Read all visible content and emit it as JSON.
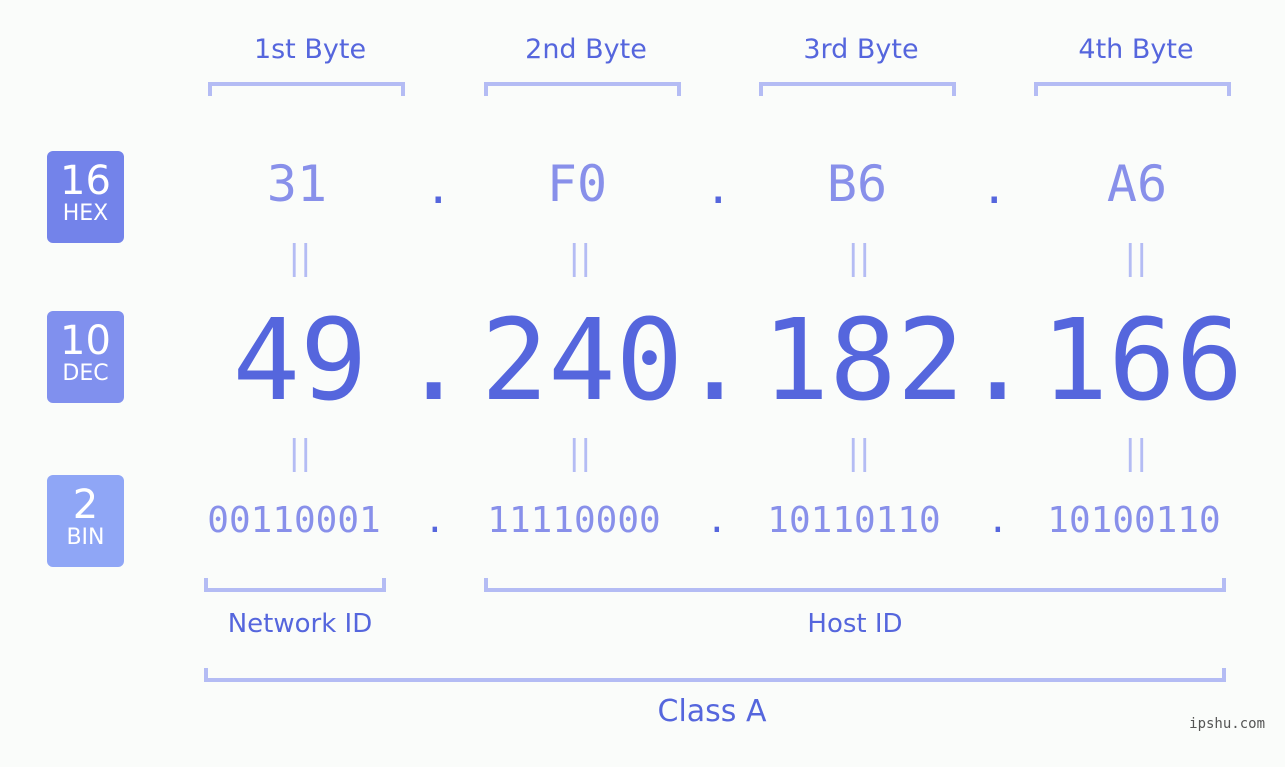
{
  "byte_labels": [
    "1st Byte",
    "2nd Byte",
    "3rd Byte",
    "4th Byte"
  ],
  "badges": {
    "hex": {
      "num": "16",
      "label": "HEX",
      "color": "#7383ea"
    },
    "dec": {
      "num": "10",
      "label": "DEC",
      "color": "#8090ee"
    },
    "bin": {
      "num": "2",
      "label": "BIN",
      "color": "#8fa6f6"
    }
  },
  "hex": [
    "31",
    "F0",
    "B6",
    "A6"
  ],
  "dec": [
    "49",
    "240",
    "182",
    "166"
  ],
  "bin": [
    "00110001",
    "11110000",
    "10110110",
    "10100110"
  ],
  "separator": ".",
  "equals": "||",
  "network_id_label": "Network ID",
  "host_id_label": "Host ID",
  "class_label": "Class A",
  "footer": "ipshu.com"
}
